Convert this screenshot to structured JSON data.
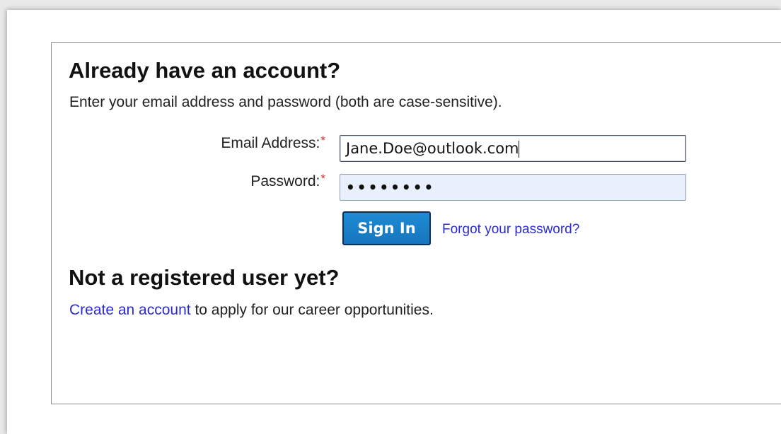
{
  "login": {
    "heading": "Already have an account?",
    "instructions": "Enter your email address and password (both are case-sensitive).",
    "email_label": "Email Address:",
    "email_value": "Jane.Doe@outlook.com",
    "password_label": "Password:",
    "password_masked": "••••••••",
    "required_mark": "*",
    "signin_label": "Sign In",
    "forgot_link": "Forgot your password?"
  },
  "register": {
    "heading": "Not a registered user yet?",
    "create_link": "Create an account",
    "create_suffix": " to apply for our career opportunities."
  },
  "colors": {
    "link": "#2b2bd4",
    "button": "#1675bd",
    "required": "#d0342c",
    "password_bg": "#e8f0fe"
  }
}
